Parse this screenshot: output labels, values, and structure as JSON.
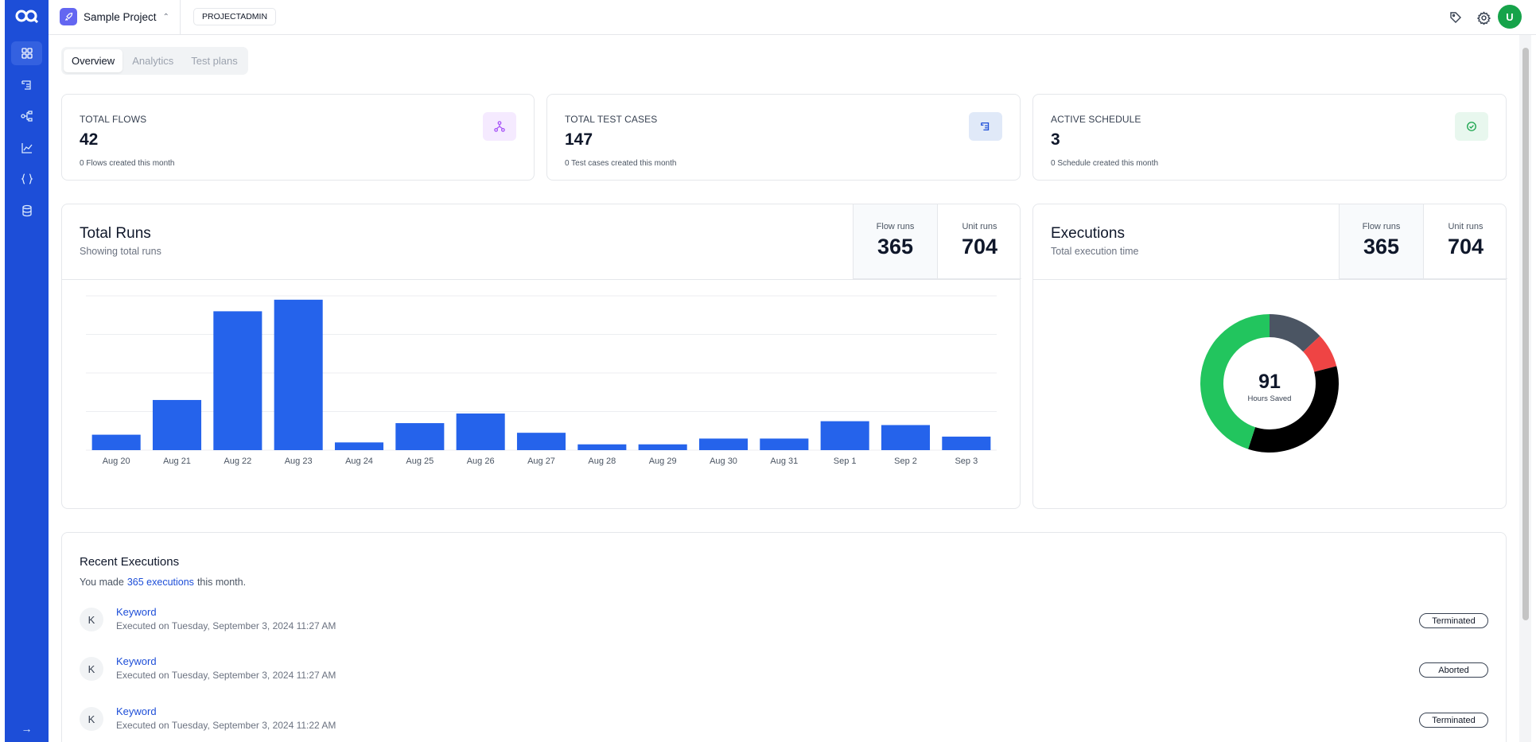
{
  "sidebar": {
    "logo_icon": "oq-logo-icon",
    "items": [
      {
        "icon": "grid-icon",
        "active": true
      },
      {
        "icon": "test-case-icon",
        "active": false
      },
      {
        "icon": "flows-icon",
        "active": false
      },
      {
        "icon": "analytics-icon",
        "active": false
      },
      {
        "icon": "braces-icon",
        "active": false
      },
      {
        "icon": "database-icon",
        "active": false
      }
    ],
    "expand_glyph": "→"
  },
  "topbar": {
    "project_name": "Sample Project",
    "role": "PROJECTADMIN",
    "avatar_letter": "U"
  },
  "tabs": [
    {
      "label": "Overview",
      "active": true
    },
    {
      "label": "Analytics",
      "active": false
    },
    {
      "label": "Test plans",
      "active": false
    }
  ],
  "stats": [
    {
      "label": "TOTAL FLOWS",
      "value": "42",
      "sub": "0 Flows created this month",
      "icon": "flows-icon",
      "icon_bg": "#f5eaff",
      "icon_color": "#a855f7"
    },
    {
      "label": "TOTAL TEST CASES",
      "value": "147",
      "sub": "0 Test cases created this month",
      "icon": "test-case-icon",
      "icon_bg": "#e0e9f8",
      "icon_color": "#1d4ed8"
    },
    {
      "label": "ACTIVE SCHEDULE",
      "value": "3",
      "sub": "0 Schedule created this month",
      "icon": "check-circle-icon",
      "icon_bg": "#e8f7ee",
      "icon_color": "#16a34a"
    }
  ],
  "total_runs": {
    "title": "Total Runs",
    "subtitle": "Showing total runs",
    "flow_runs_label": "Flow runs",
    "flow_runs_value": "365",
    "unit_runs_label": "Unit runs",
    "unit_runs_value": "704"
  },
  "executions": {
    "title": "Executions",
    "subtitle": "Total execution time",
    "flow_runs_label": "Flow runs",
    "flow_runs_value": "365",
    "unit_runs_label": "Unit runs",
    "unit_runs_value": "704",
    "center_value": "91",
    "center_label": "Hours Saved"
  },
  "chart_data": [
    {
      "type": "bar",
      "categories": [
        "Aug 20",
        "Aug 21",
        "Aug 22",
        "Aug 23",
        "Aug 24",
        "Aug 25",
        "Aug 26",
        "Aug 27",
        "Aug 28",
        "Aug 29",
        "Aug 30",
        "Aug 31",
        "Sep 1",
        "Sep 2",
        "Sep 3"
      ],
      "values": [
        8,
        26,
        72,
        78,
        4,
        14,
        19,
        9,
        3,
        3,
        6,
        6,
        15,
        13,
        7
      ],
      "ylim": [
        0,
        80
      ],
      "grid": true,
      "color": "#2563eb"
    },
    {
      "type": "pie",
      "donut": true,
      "values": [
        13,
        8,
        34,
        45
      ],
      "colors": [
        "#4b5563",
        "#ef4444",
        "#000000",
        "#22c55e"
      ]
    }
  ],
  "recent": {
    "title": "Recent Executions",
    "sub_prefix": "You made",
    "sub_link": "365 executions",
    "sub_suffix": "this month.",
    "rows": [
      {
        "avatar": "K",
        "name": "Keyword",
        "time": "Executed on Tuesday, September 3, 2024 11:27 AM",
        "status": "Terminated"
      },
      {
        "avatar": "K",
        "name": "Keyword",
        "time": "Executed on Tuesday, September 3, 2024 11:27 AM",
        "status": "Aborted"
      },
      {
        "avatar": "K",
        "name": "Keyword",
        "time": "Executed on Tuesday, September 3, 2024 11:22 AM",
        "status": "Terminated"
      }
    ]
  }
}
